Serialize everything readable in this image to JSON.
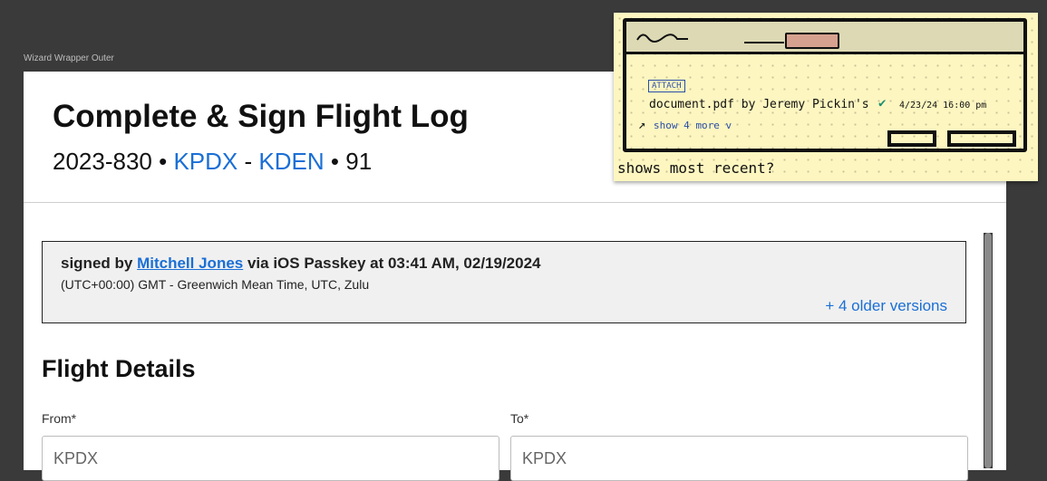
{
  "wrapper": {
    "label": "Wizard Wrapper Outer"
  },
  "header": {
    "title": "Complete & Sign Flight Log",
    "flight_id": "2023-830",
    "bullet": "•",
    "origin": "KPDX",
    "dash": "-",
    "destination": "KDEN",
    "bullet2": "•",
    "tail": "91"
  },
  "signature": {
    "prefix": "signed by",
    "signer": "Mitchell Jones",
    "suffix": "via iOS Passkey at 03:41 AM, 02/19/2024",
    "timezone": "(UTC+00:00) GMT - Greenwich Mean Time, UTC, Zulu",
    "older_versions": "+ 4 older versions"
  },
  "flight_details": {
    "title": "Flight Details",
    "from_label": "From*",
    "from_value": "KPDX",
    "to_label": "To*",
    "to_value": "KPDX"
  },
  "sticky_note": {
    "attach_tag": "ATTACH",
    "document_line": "document.pdf by Jeremy Pickin's",
    "date": "4/23/24 16:00 pm",
    "show_more": "show 4 more v",
    "note": "shows most recent?"
  },
  "colors": {
    "link": "#1a6fd6",
    "sticky": "#fdf6c0"
  }
}
